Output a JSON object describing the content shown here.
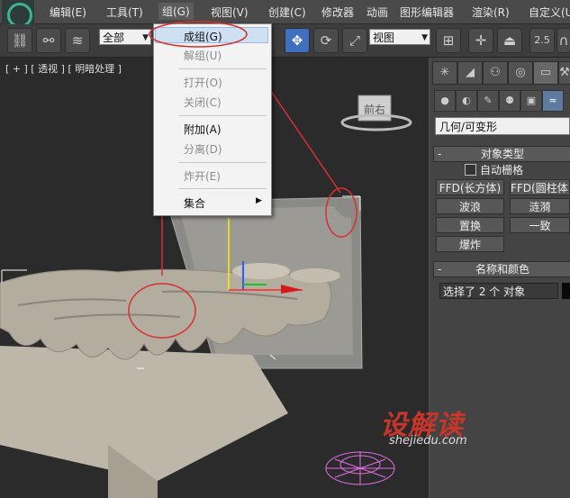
{
  "menubar": {
    "items": [
      "编辑(E)",
      "工具(T)",
      "组(G)",
      "视图(V)",
      "创建(C)",
      "修改器",
      "动画",
      "图形编辑器",
      "渲染(R)",
      "自定义(U"
    ]
  },
  "toolbar": {
    "selection_filter": "全部",
    "reference_coord": "视图",
    "snap_value": "2.5"
  },
  "viewport": {
    "label": "[ + ] [ 透视 ] [ 明暗处理 ]",
    "viewcube_face": "前右"
  },
  "group_menu": {
    "items": [
      {
        "label": "成组(G)",
        "enabled": true
      },
      {
        "label": "解组(U)",
        "enabled": false
      },
      {
        "label": "打开(O)",
        "enabled": false
      },
      {
        "label": "关闭(C)",
        "enabled": false
      },
      {
        "label": "附加(A)",
        "enabled": true
      },
      {
        "label": "分离(D)",
        "enabled": false
      },
      {
        "label": "炸开(E)",
        "enabled": false
      },
      {
        "label": "集合",
        "enabled": true
      }
    ]
  },
  "command_panel": {
    "category_dropdown": "几何/可变形",
    "object_type_title": "对象类型",
    "autogrid_label": "自动栅格",
    "buttons": [
      "FFD(长方体)",
      "FFD(圆柱体)",
      "波浪",
      "涟漪",
      "置换",
      "一致",
      "爆炸"
    ],
    "name_color_title": "名称和颜色",
    "name_field_value": "选择了 2 个 对象",
    "minus": "-"
  },
  "watermark": {
    "brand": "设解读",
    "url": "shejiedu.com"
  },
  "colors": {
    "annotation_red": "#d83030",
    "menu_highlight": "#cfe0f3",
    "brand_red": "#c7352b"
  }
}
